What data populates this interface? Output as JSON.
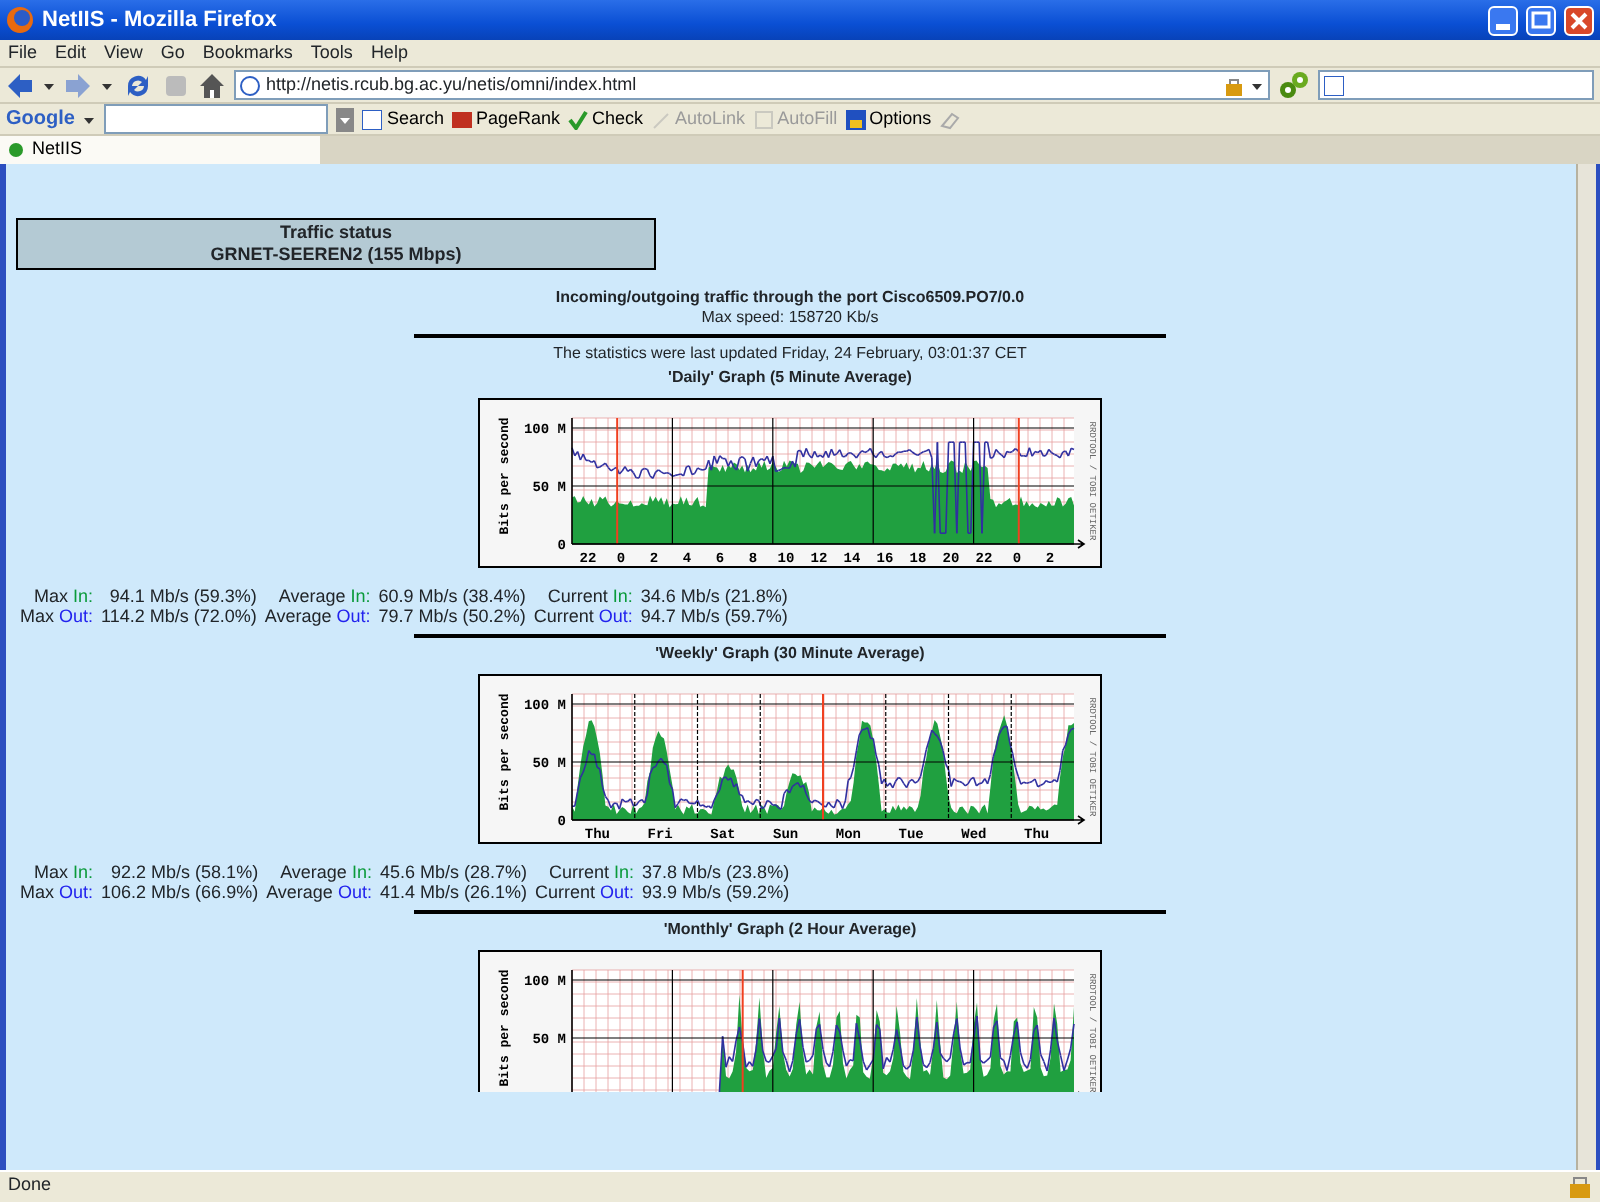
{
  "window": {
    "title": "NetIIS - Mozilla Firefox"
  },
  "menu": [
    "File",
    "Edit",
    "View",
    "Go",
    "Bookmarks",
    "Tools",
    "Help"
  ],
  "address_bar": {
    "value": "http://netis.rcub.bg.ac.yu/netis/omni/index.html"
  },
  "google_toolbar": {
    "logo": "Google",
    "items": [
      {
        "label": "Search",
        "disabled": false
      },
      {
        "label": "PageRank",
        "disabled": false
      },
      {
        "label": "Check",
        "disabled": false
      },
      {
        "label": "AutoLink",
        "disabled": true
      },
      {
        "label": "AutoFill",
        "disabled": true
      },
      {
        "label": "Options",
        "disabled": false
      }
    ]
  },
  "tabs": [
    {
      "label": "NetIIS",
      "selected": true
    }
  ],
  "page": {
    "header": [
      "Traffic status",
      "GRNET-SEEREN2 (155 Mbps)"
    ],
    "port_line": "Incoming/outgoing traffic through the port Cisco6509.PO7/0.0",
    "max_speed": "Max speed: 158720 Kb/s",
    "updated": "The statistics were last updated Friday, 24 February, 03:01:37 CET",
    "graphs": [
      {
        "kind": "daily",
        "title": "'Daily' Graph (5 Minute Average)",
        "ylabel": "Bits per second",
        "credit": "RRDTOOL / TOBI OETIKER",
        "yticks": [
          "100 M",
          "50 M",
          "0"
        ],
        "xticks": [
          "22",
          "0",
          "2",
          "4",
          "6",
          "8",
          "10",
          "12",
          "14",
          "16",
          "18",
          "20",
          "22",
          "0",
          "2"
        ],
        "stats": [
          [
            {
              "label": "Max",
              "dir": "In:",
              "kind": "in",
              "value": "94.1 Mb/s (59.3%)"
            },
            {
              "label": "Average",
              "dir": "In:",
              "kind": "in",
              "value": "60.9 Mb/s (38.4%)"
            },
            {
              "label": "Current",
              "dir": "In:",
              "kind": "in",
              "value": "34.6 Mb/s (21.8%)"
            }
          ],
          [
            {
              "label": "Max",
              "dir": "Out:",
              "kind": "out",
              "value": "114.2 Mb/s (72.0%)"
            },
            {
              "label": "Average",
              "dir": "Out:",
              "kind": "out",
              "value": "79.7 Mb/s (50.2%)"
            },
            {
              "label": "Current",
              "dir": "Out:",
              "kind": "out",
              "value": "94.7 Mb/s (59.7%)"
            }
          ]
        ]
      },
      {
        "kind": "weekly",
        "title": "'Weekly' Graph (30 Minute Average)",
        "ylabel": "Bits per second",
        "credit": "RRDTOOL / TOBI OETIKER",
        "yticks": [
          "100 M",
          "50 M",
          "0"
        ],
        "xticks": [
          "Thu",
          "Fri",
          "Sat",
          "Sun",
          "Mon",
          "Tue",
          "Wed",
          "Thu"
        ],
        "stats": [
          [
            {
              "label": "Max",
              "dir": "In:",
              "kind": "in",
              "value": "92.2 Mb/s (58.1%)"
            },
            {
              "label": "Average",
              "dir": "In:",
              "kind": "in",
              "value": "45.6 Mb/s (28.7%)"
            },
            {
              "label": "Current",
              "dir": "In:",
              "kind": "in",
              "value": "37.8 Mb/s (23.8%)"
            }
          ],
          [
            {
              "label": "Max",
              "dir": "Out:",
              "kind": "out",
              "value": "106.2 Mb/s (66.9%)"
            },
            {
              "label": "Average",
              "dir": "Out:",
              "kind": "out",
              "value": "41.4 Mb/s (26.1%)"
            },
            {
              "label": "Current",
              "dir": "Out:",
              "kind": "out",
              "value": "93.9 Mb/s (59.2%)"
            }
          ]
        ]
      },
      {
        "kind": "monthly",
        "title": "'Monthly' Graph (2 Hour Average)",
        "ylabel": "Bits per second",
        "credit": "RRDTOOL / TOBI OETIKER",
        "yticks": [
          "100 M",
          "50 M"
        ]
      }
    ]
  },
  "status_bar": {
    "text": "Done"
  }
}
